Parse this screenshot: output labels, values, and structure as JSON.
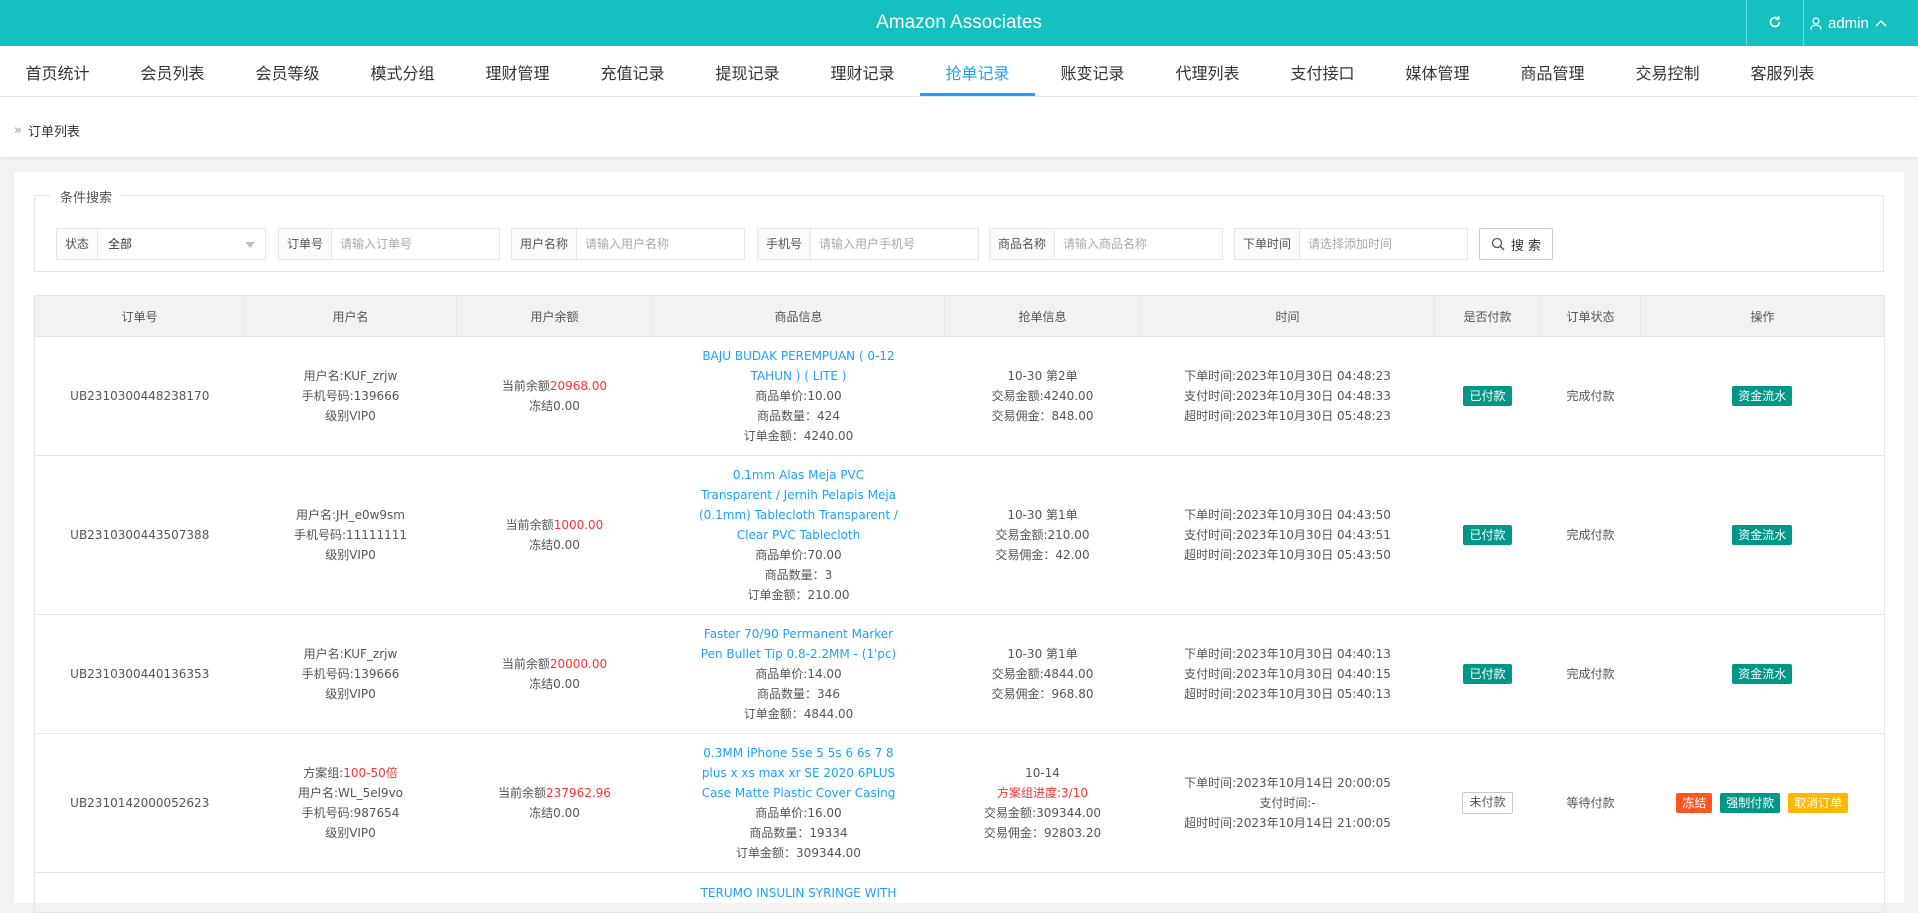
{
  "header": {
    "title": "Amazon Associates",
    "user": "admin"
  },
  "nav": [
    {
      "label": "首页统计",
      "active": false
    },
    {
      "label": "会员列表",
      "active": false
    },
    {
      "label": "会员等级",
      "active": false
    },
    {
      "label": "模式分组",
      "active": false
    },
    {
      "label": "理财管理",
      "active": false
    },
    {
      "label": "充值记录",
      "active": false
    },
    {
      "label": "提现记录",
      "active": false
    },
    {
      "label": "理财记录",
      "active": false
    },
    {
      "label": "抢单记录",
      "active": true
    },
    {
      "label": "账变记录",
      "active": false
    },
    {
      "label": "代理列表",
      "active": false
    },
    {
      "label": "支付接口",
      "active": false
    },
    {
      "label": "媒体管理",
      "active": false
    },
    {
      "label": "商品管理",
      "active": false
    },
    {
      "label": "交易控制",
      "active": false
    },
    {
      "label": "客服列表",
      "active": false
    }
  ],
  "breadcrumb": "订单列表",
  "search": {
    "legend": "条件搜索",
    "status_label": "状态",
    "status_value": "全部",
    "order_label": "订单号",
    "order_placeholder": "请输入订单号",
    "username_label": "用户名称",
    "username_placeholder": "请输入用户名称",
    "phone_label": "手机号",
    "phone_placeholder": "请输入用户手机号",
    "goods_label": "商品名称",
    "goods_placeholder": "请输入商品名称",
    "time_label": "下单时间",
    "time_placeholder": "请选择添加时间",
    "button": "搜 索"
  },
  "table": {
    "columns": [
      "订单号",
      "用户名",
      "用户余额",
      "商品信息",
      "抢单信息",
      "时间",
      "是否付款",
      "订单状态",
      "操作"
    ],
    "rows": [
      {
        "order_no": "UB2310300448238170",
        "user_lines": [
          "用户名:KUF_zrjw",
          "手机号码:139666",
          "级别VIP0"
        ],
        "bal_prefix": "当前余额",
        "bal_value": "20968.00",
        "frozen": "冻结0.00",
        "goods_title": "BAJU BUDAK PEREMPUAN ( 0-12 TAHUN ) ( LITE )",
        "goods_lines": [
          "商品单价:10.00",
          "商品数量：424",
          "订单金额：4240.00"
        ],
        "grab_lines": [
          "10-30 第2单",
          "交易金额:4240.00",
          "交易佣金：848.00"
        ],
        "time_lines": [
          "下单时间:2023年10月30日 04:48:23",
          "支付时间:2023年10月30日 04:48:33",
          "超时时间:2023年10月30日 05:48:23"
        ],
        "pay": "已付款",
        "status": "完成付款",
        "actions": [
          "资金流水"
        ]
      },
      {
        "order_no": "UB2310300443507388",
        "user_lines": [
          "用户名:JH_e0w9sm",
          "手机号码:11111111",
          "级别VIP0"
        ],
        "bal_prefix": "当前余额",
        "bal_value": "1000.00",
        "frozen": "冻结0.00",
        "goods_title": "0.1mm Alas Meja PVC Transparent / Jernih Pelapis Meja (0.1mm) Tablecloth Transparent / Clear PVC Tablecloth",
        "goods_lines": [
          "商品单价:70.00",
          "商品数量：3",
          "订单金额：210.00"
        ],
        "grab_lines": [
          "10-30 第1单",
          "交易金额:210.00",
          "交易佣金：42.00"
        ],
        "time_lines": [
          "下单时间:2023年10月30日 04:43:50",
          "支付时间:2023年10月30日 04:43:51",
          "超时时间:2023年10月30日 05:43:50"
        ],
        "pay": "已付款",
        "status": "完成付款",
        "actions": [
          "资金流水"
        ]
      },
      {
        "order_no": "UB2310300440136353",
        "user_lines": [
          "用户名:KUF_zrjw",
          "手机号码:139666",
          "级别VIP0"
        ],
        "bal_prefix": "当前余额",
        "bal_value": "20000.00",
        "frozen": "冻结0.00",
        "goods_title": "Faster 70/90 Permanent Marker Pen Bullet Tip 0.8-2.2MM - (1'pc)",
        "goods_lines": [
          "商品单价:14.00",
          "商品数量：346",
          "订单金额：4844.00"
        ],
        "grab_lines": [
          "10-30 第1单",
          "交易金额:4844.00",
          "交易佣金：968.80"
        ],
        "time_lines": [
          "下单时间:2023年10月30日 04:40:13",
          "支付时间:2023年10月30日 04:40:15",
          "超时时间:2023年10月30日 05:40:13"
        ],
        "pay": "已付款",
        "status": "完成付款",
        "actions": [
          "资金流水"
        ]
      },
      {
        "order_no": "UB2310142000052623",
        "plan_prefix": "方案组:",
        "plan_value": "100-50倍",
        "user_lines": [
          "用户名:WL_5el9vo",
          "手机号码:987654",
          "级别VIP0"
        ],
        "bal_prefix": "当前余额",
        "bal_value": "237962.96",
        "frozen": "冻结0.00",
        "goods_title": "0.3MM iPhone 5se 5 5s 6 6s 7 8 plus x xs max xr SE 2020 6PLUS Case Matte Plastic Cover Casing",
        "goods_lines": [
          "商品单价:16.00",
          "商品数量：19334",
          "订单金额：309344.00"
        ],
        "grab_first": "10-14",
        "grab_progress": "方案组进度:3/10",
        "grab_lines": [
          "交易金额:309344.00",
          "交易佣金：92803.20"
        ],
        "time_lines": [
          "下单时间:2023年10月14日 20:00:05",
          "支付时间:-",
          "超时时间:2023年10月14日 21:00:05"
        ],
        "pay": "未付款",
        "status": "等待付款",
        "actions": [
          "冻结",
          "强制付款",
          "取消订单"
        ]
      },
      {
        "goods_title": "TERUMO INSULIN SYRINGE WITH"
      }
    ]
  }
}
